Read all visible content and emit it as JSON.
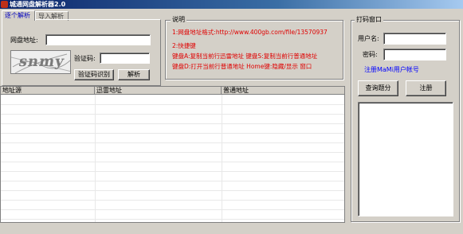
{
  "window": {
    "title": "城通网盘解析器2.0"
  },
  "tabs": [
    {
      "label": "逐个解析"
    },
    {
      "label": "导入解析"
    }
  ],
  "parse_form": {
    "url_label": "网盘地址:",
    "url_value": "",
    "captcha_text": "snmy",
    "code_label": "验证码:",
    "code_value": "",
    "recognize_button": "验证码识别",
    "parse_button": "解析"
  },
  "notes": {
    "title": "说明",
    "lines": [
      "1:网盘地址格式:http://www.400gb.com/file/13570937",
      "2:快捷键",
      "键盘A:复制当前行迅雷地址 键盘S:复制当前行普通地址",
      "键盘D:打开当前行普通地址 Home键:隐藏/显示 窗口"
    ]
  },
  "table": {
    "columns": [
      "地址源",
      "迅雷地址",
      "普通地址"
    ],
    "rows": []
  },
  "captcha_panel": {
    "title": "打码窗口",
    "username_label": "用户名:",
    "username_value": "",
    "password_label": "密码:",
    "password_value": "",
    "register_link": "注册MaMi用户帐号",
    "query_button": "查询题分",
    "register_button": "注册",
    "log_text": ""
  }
}
